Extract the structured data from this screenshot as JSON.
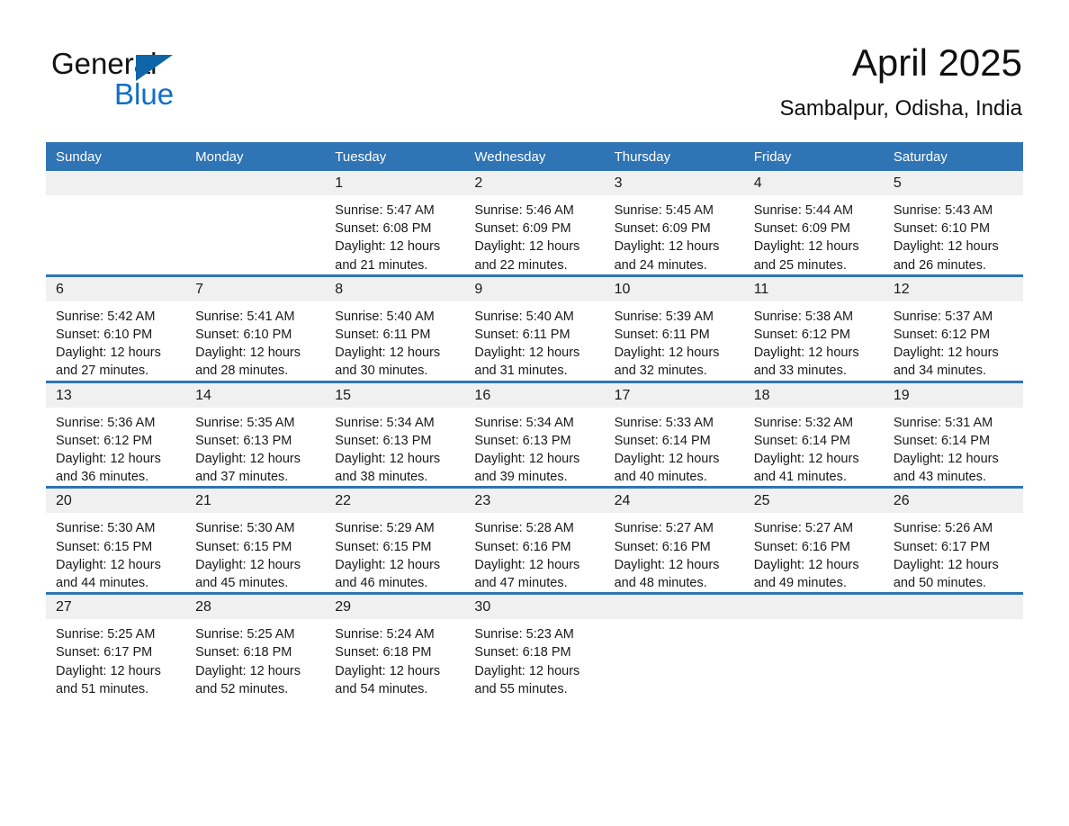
{
  "brand": {
    "logo_line1": "General",
    "logo_line2": "Blue",
    "accent_color": "#0f6fc6",
    "triangle_color": "#1064a8",
    "triangle_icon": "triangle-right-icon"
  },
  "header": {
    "month_title": "April 2025",
    "location": "Sambalpur, Odisha, India"
  },
  "colors": {
    "header_blue": "#2f74b5",
    "daynum_background": "#f0f0f0",
    "text": "#1a1a1a",
    "page_background": "#ffffff"
  },
  "calendar": {
    "weekday_headers": [
      "Sunday",
      "Monday",
      "Tuesday",
      "Wednesday",
      "Thursday",
      "Friday",
      "Saturday"
    ],
    "weeks": [
      [
        {
          "day": "",
          "sunrise": "",
          "sunset": "",
          "daylight_line1": "",
          "daylight_line2": "",
          "blank": true
        },
        {
          "day": "",
          "sunrise": "",
          "sunset": "",
          "daylight_line1": "",
          "daylight_line2": "",
          "blank": true
        },
        {
          "day": "1",
          "sunrise": "Sunrise: 5:47 AM",
          "sunset": "Sunset: 6:08 PM",
          "daylight_line1": "Daylight: 12 hours",
          "daylight_line2": "and 21 minutes."
        },
        {
          "day": "2",
          "sunrise": "Sunrise: 5:46 AM",
          "sunset": "Sunset: 6:09 PM",
          "daylight_line1": "Daylight: 12 hours",
          "daylight_line2": "and 22 minutes."
        },
        {
          "day": "3",
          "sunrise": "Sunrise: 5:45 AM",
          "sunset": "Sunset: 6:09 PM",
          "daylight_line1": "Daylight: 12 hours",
          "daylight_line2": "and 24 minutes."
        },
        {
          "day": "4",
          "sunrise": "Sunrise: 5:44 AM",
          "sunset": "Sunset: 6:09 PM",
          "daylight_line1": "Daylight: 12 hours",
          "daylight_line2": "and 25 minutes."
        },
        {
          "day": "5",
          "sunrise": "Sunrise: 5:43 AM",
          "sunset": "Sunset: 6:10 PM",
          "daylight_line1": "Daylight: 12 hours",
          "daylight_line2": "and 26 minutes."
        }
      ],
      [
        {
          "day": "6",
          "sunrise": "Sunrise: 5:42 AM",
          "sunset": "Sunset: 6:10 PM",
          "daylight_line1": "Daylight: 12 hours",
          "daylight_line2": "and 27 minutes."
        },
        {
          "day": "7",
          "sunrise": "Sunrise: 5:41 AM",
          "sunset": "Sunset: 6:10 PM",
          "daylight_line1": "Daylight: 12 hours",
          "daylight_line2": "and 28 minutes."
        },
        {
          "day": "8",
          "sunrise": "Sunrise: 5:40 AM",
          "sunset": "Sunset: 6:11 PM",
          "daylight_line1": "Daylight: 12 hours",
          "daylight_line2": "and 30 minutes."
        },
        {
          "day": "9",
          "sunrise": "Sunrise: 5:40 AM",
          "sunset": "Sunset: 6:11 PM",
          "daylight_line1": "Daylight: 12 hours",
          "daylight_line2": "and 31 minutes."
        },
        {
          "day": "10",
          "sunrise": "Sunrise: 5:39 AM",
          "sunset": "Sunset: 6:11 PM",
          "daylight_line1": "Daylight: 12 hours",
          "daylight_line2": "and 32 minutes."
        },
        {
          "day": "11",
          "sunrise": "Sunrise: 5:38 AM",
          "sunset": "Sunset: 6:12 PM",
          "daylight_line1": "Daylight: 12 hours",
          "daylight_line2": "and 33 minutes."
        },
        {
          "day": "12",
          "sunrise": "Sunrise: 5:37 AM",
          "sunset": "Sunset: 6:12 PM",
          "daylight_line1": "Daylight: 12 hours",
          "daylight_line2": "and 34 minutes."
        }
      ],
      [
        {
          "day": "13",
          "sunrise": "Sunrise: 5:36 AM",
          "sunset": "Sunset: 6:12 PM",
          "daylight_line1": "Daylight: 12 hours",
          "daylight_line2": "and 36 minutes."
        },
        {
          "day": "14",
          "sunrise": "Sunrise: 5:35 AM",
          "sunset": "Sunset: 6:13 PM",
          "daylight_line1": "Daylight: 12 hours",
          "daylight_line2": "and 37 minutes."
        },
        {
          "day": "15",
          "sunrise": "Sunrise: 5:34 AM",
          "sunset": "Sunset: 6:13 PM",
          "daylight_line1": "Daylight: 12 hours",
          "daylight_line2": "and 38 minutes."
        },
        {
          "day": "16",
          "sunrise": "Sunrise: 5:34 AM",
          "sunset": "Sunset: 6:13 PM",
          "daylight_line1": "Daylight: 12 hours",
          "daylight_line2": "and 39 minutes."
        },
        {
          "day": "17",
          "sunrise": "Sunrise: 5:33 AM",
          "sunset": "Sunset: 6:14 PM",
          "daylight_line1": "Daylight: 12 hours",
          "daylight_line2": "and 40 minutes."
        },
        {
          "day": "18",
          "sunrise": "Sunrise: 5:32 AM",
          "sunset": "Sunset: 6:14 PM",
          "daylight_line1": "Daylight: 12 hours",
          "daylight_line2": "and 41 minutes."
        },
        {
          "day": "19",
          "sunrise": "Sunrise: 5:31 AM",
          "sunset": "Sunset: 6:14 PM",
          "daylight_line1": "Daylight: 12 hours",
          "daylight_line2": "and 43 minutes."
        }
      ],
      [
        {
          "day": "20",
          "sunrise": "Sunrise: 5:30 AM",
          "sunset": "Sunset: 6:15 PM",
          "daylight_line1": "Daylight: 12 hours",
          "daylight_line2": "and 44 minutes."
        },
        {
          "day": "21",
          "sunrise": "Sunrise: 5:30 AM",
          "sunset": "Sunset: 6:15 PM",
          "daylight_line1": "Daylight: 12 hours",
          "daylight_line2": "and 45 minutes."
        },
        {
          "day": "22",
          "sunrise": "Sunrise: 5:29 AM",
          "sunset": "Sunset: 6:15 PM",
          "daylight_line1": "Daylight: 12 hours",
          "daylight_line2": "and 46 minutes."
        },
        {
          "day": "23",
          "sunrise": "Sunrise: 5:28 AM",
          "sunset": "Sunset: 6:16 PM",
          "daylight_line1": "Daylight: 12 hours",
          "daylight_line2": "and 47 minutes."
        },
        {
          "day": "24",
          "sunrise": "Sunrise: 5:27 AM",
          "sunset": "Sunset: 6:16 PM",
          "daylight_line1": "Daylight: 12 hours",
          "daylight_line2": "and 48 minutes."
        },
        {
          "day": "25",
          "sunrise": "Sunrise: 5:27 AM",
          "sunset": "Sunset: 6:16 PM",
          "daylight_line1": "Daylight: 12 hours",
          "daylight_line2": "and 49 minutes."
        },
        {
          "day": "26",
          "sunrise": "Sunrise: 5:26 AM",
          "sunset": "Sunset: 6:17 PM",
          "daylight_line1": "Daylight: 12 hours",
          "daylight_line2": "and 50 minutes."
        }
      ],
      [
        {
          "day": "27",
          "sunrise": "Sunrise: 5:25 AM",
          "sunset": "Sunset: 6:17 PM",
          "daylight_line1": "Daylight: 12 hours",
          "daylight_line2": "and 51 minutes."
        },
        {
          "day": "28",
          "sunrise": "Sunrise: 5:25 AM",
          "sunset": "Sunset: 6:18 PM",
          "daylight_line1": "Daylight: 12 hours",
          "daylight_line2": "and 52 minutes."
        },
        {
          "day": "29",
          "sunrise": "Sunrise: 5:24 AM",
          "sunset": "Sunset: 6:18 PM",
          "daylight_line1": "Daylight: 12 hours",
          "daylight_line2": "and 54 minutes."
        },
        {
          "day": "30",
          "sunrise": "Sunrise: 5:23 AM",
          "sunset": "Sunset: 6:18 PM",
          "daylight_line1": "Daylight: 12 hours",
          "daylight_line2": "and 55 minutes."
        },
        {
          "day": "",
          "sunrise": "",
          "sunset": "",
          "daylight_line1": "",
          "daylight_line2": "",
          "blank": true
        },
        {
          "day": "",
          "sunrise": "",
          "sunset": "",
          "daylight_line1": "",
          "daylight_line2": "",
          "blank": true
        },
        {
          "day": "",
          "sunrise": "",
          "sunset": "",
          "daylight_line1": "",
          "daylight_line2": "",
          "blank": true
        }
      ]
    ]
  }
}
